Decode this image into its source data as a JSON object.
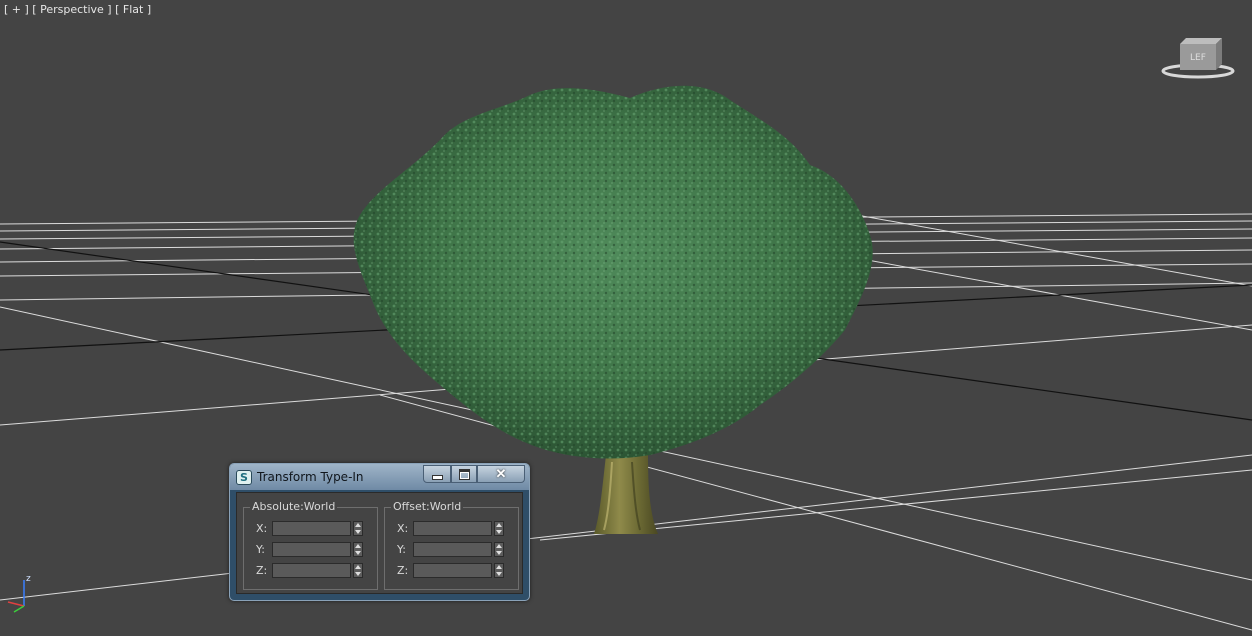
{
  "viewport": {
    "label_plus": "[ + ]",
    "label_view": "[ Perspective ]",
    "label_shading": "[ Flat ]",
    "background_color": "#444444",
    "grid_color": "#e0e0e0",
    "viewcube_label": "LEF",
    "axis_label": "z"
  },
  "dialog": {
    "title": "Transform Type-In",
    "close_glyph": "✕",
    "absolute_group": {
      "title": "Absolute:World",
      "fields": [
        {
          "label": "X:",
          "value": ""
        },
        {
          "label": "Y:",
          "value": ""
        },
        {
          "label": "Z:",
          "value": ""
        }
      ]
    },
    "offset_group": {
      "title": "Offset:World",
      "fields": [
        {
          "label": "X:",
          "value": ""
        },
        {
          "label": "Y:",
          "value": ""
        },
        {
          "label": "Z:",
          "value": ""
        }
      ]
    }
  },
  "icons": {
    "app": "3dsmax-logo-icon",
    "minimize": "minimize-icon",
    "maximize": "maximize-icon",
    "close": "close-icon"
  }
}
